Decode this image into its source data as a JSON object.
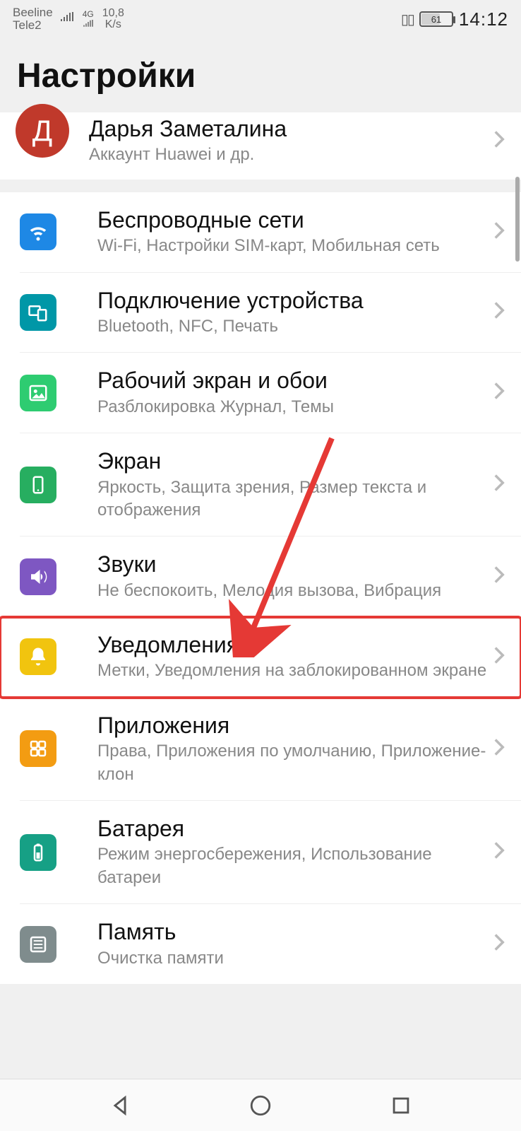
{
  "status": {
    "carrier1": "Beeline",
    "carrier2": "Tele2",
    "net_label": "4G",
    "speed_top": "10,8",
    "speed_bot": "K/s",
    "battery": "61",
    "time": "14:12"
  },
  "page_title": "Настройки",
  "account": {
    "avatar_letter": "Д",
    "name": "Дарья Заметалина",
    "sub": "Аккаунт Huawei и др."
  },
  "rows": {
    "wireless": {
      "title": "Беспроводные сети",
      "sub": "Wi-Fi, Настройки SIM-карт, Мобильная сеть"
    },
    "connect": {
      "title": "Подключение устройства",
      "sub": "Bluetooth, NFC, Печать"
    },
    "home": {
      "title": "Рабочий экран и обои",
      "sub": "Разблокировка Журнал, Темы"
    },
    "display": {
      "title": "Экран",
      "sub": "Яркость, Защита зрения, Размер текста и отображения"
    },
    "sounds": {
      "title": "Звуки",
      "sub": "Не беспокоить, Мелодия вызова, Вибрация"
    },
    "notif": {
      "title": "Уведомления",
      "sub": "Метки, Уведомления на заблокированном экране"
    },
    "apps": {
      "title": "Приложения",
      "sub": "Права, Приложения по умолчанию, Приложение-клон"
    },
    "battery": {
      "title": "Батарея",
      "sub": "Режим энергосбережения, Использование батареи"
    },
    "storage": {
      "title": "Память",
      "sub": "Очистка памяти"
    }
  }
}
